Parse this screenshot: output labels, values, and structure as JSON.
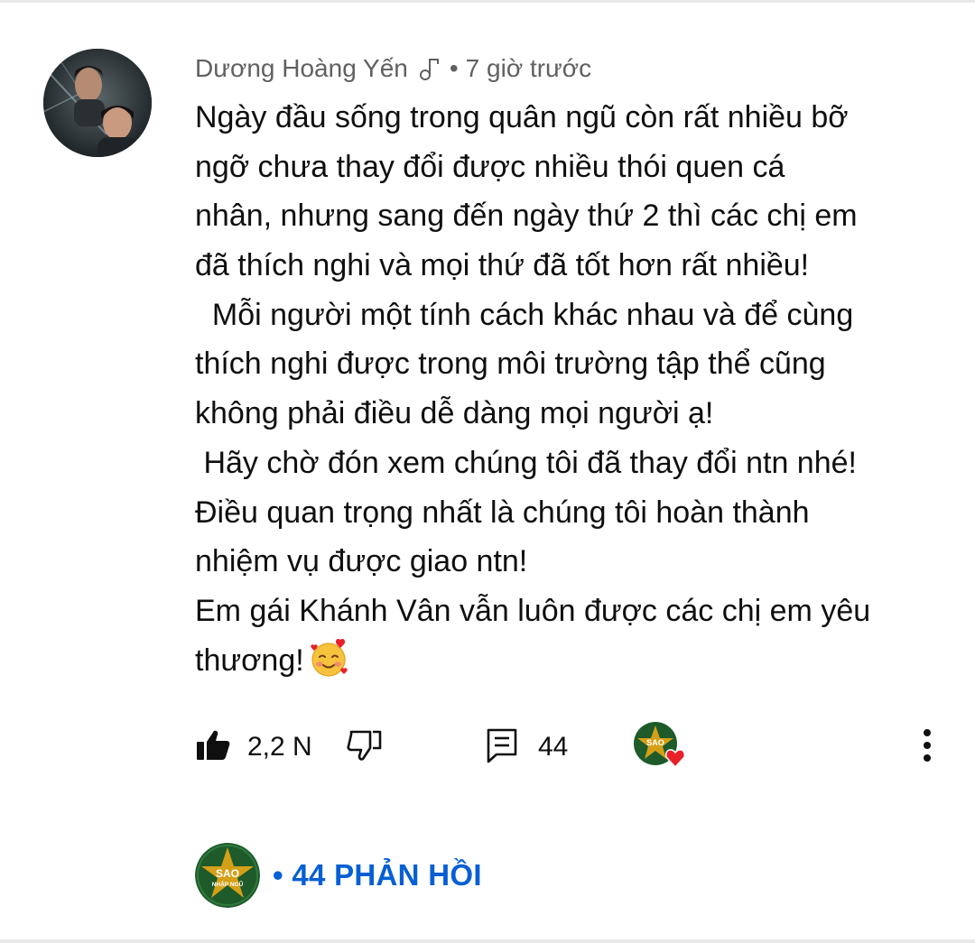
{
  "comment": {
    "author": "Dương Hoàng Yến",
    "author_badge_icon": "music-note-icon",
    "separator": "•",
    "timestamp": "7 giờ trước",
    "lines": [
      "Ngày đầu sống trong quân ngũ còn rất nhiều bỡ",
      "ngỡ chưa thay đổi được nhiều thói quen cá",
      "nhân, nhưng sang đến ngày thứ 2 thì các chị em",
      "đã thích nghi và mọi thứ đã tốt hơn rất nhiều!",
      "  Mỗi người một tính cách khác nhau và để cùng",
      "thích nghi được trong môi trường tập thể cũng",
      "không phải điều dễ dàng mọi người ạ!",
      " Hãy chờ đón xem chúng tôi đã thay đổi ntn nhé!",
      "Điều quan trọng nhất là chúng tôi hoàn thành",
      "nhiệm vụ được giao ntn!",
      "Em gái Khánh Vân vẫn luôn được các chị em yêu",
      "thương!"
    ],
    "trailing_emoji": "smiling-face-with-hearts-emoji"
  },
  "actions": {
    "like_count": "2,2 N",
    "reply_count": "44",
    "like_icon": "thumbs-up-icon",
    "dislike_icon": "thumbs-down-icon",
    "reply_icon": "reply-comment-icon",
    "creator_heart_icon": "creator-heart-icon",
    "more_icon": "more-vertical-icon"
  },
  "channel": {
    "logo_text_top": "SAO",
    "logo_text_bottom": "NHẬP NGŨ"
  },
  "replies": {
    "label": "• 44 PHẢN HỒI"
  },
  "colors": {
    "link_blue": "#065fd4",
    "meta_gray": "#606060",
    "heart_red": "#e8202a",
    "channel_green": "#1e5a2a",
    "star_gold": "#d4a017"
  }
}
